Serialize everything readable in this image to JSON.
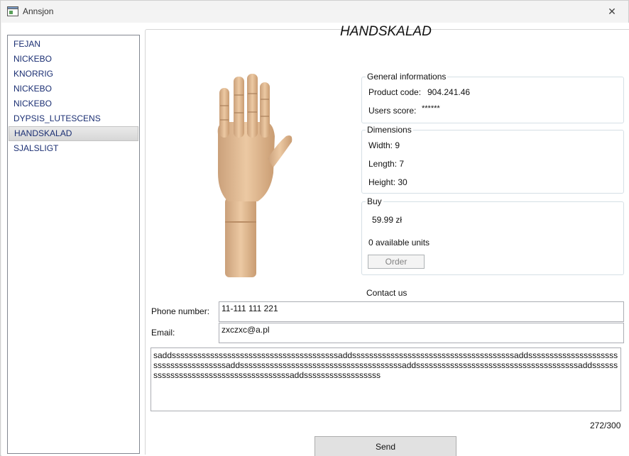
{
  "window": {
    "title": "Annsjon",
    "close_glyph": "✕"
  },
  "sidebar": {
    "items": [
      {
        "label": "FEJAN"
      },
      {
        "label": "NICKEBO"
      },
      {
        "label": "KNORRIG"
      },
      {
        "label": "NICKEBO"
      },
      {
        "label": "NICKEBO"
      },
      {
        "label": "DYPSIS_LUTESCENS"
      },
      {
        "label": "HANDSKALAD",
        "selected": true
      },
      {
        "label": "SJALSLIGT"
      }
    ]
  },
  "product": {
    "title": "HANDSKALAD",
    "image_icon": "wooden-hand-model"
  },
  "general": {
    "legend": "General informations",
    "code_label": "Product code:",
    "code_value": "904.241.46",
    "score_label": "Users score:",
    "score_value": "******"
  },
  "dimensions": {
    "legend": "Dimensions",
    "width": "Width: 9",
    "length": "Length: 7",
    "height": "Height: 30"
  },
  "buy": {
    "legend": "Buy",
    "price": "59.99 zł",
    "available": "0 available units",
    "order_label": "Order"
  },
  "contact": {
    "heading": "Contact us",
    "phone_label": "Phone number:",
    "phone_value": "11-111 111 221",
    "email_label": "Email:",
    "email_value": "zxczxc@a.pl",
    "message": "saddsssssssssssssssssssssssssssssssssssssssaddssssssssssssssssssssssssssssssssssssssaddssssssssssssssssssssssssssssssssssssssaddssssssssssssssssssssssssssssssssssssssaddssssssssssssssssssssssssssssssssssssssaddssssssssssssssssssssssssssssssssssssssaddssssssssssssssssss",
    "counter": "272/300",
    "send_label": "Send"
  },
  "colors": {
    "list_text": "#1b2f73",
    "wood": "#e2bc94"
  }
}
